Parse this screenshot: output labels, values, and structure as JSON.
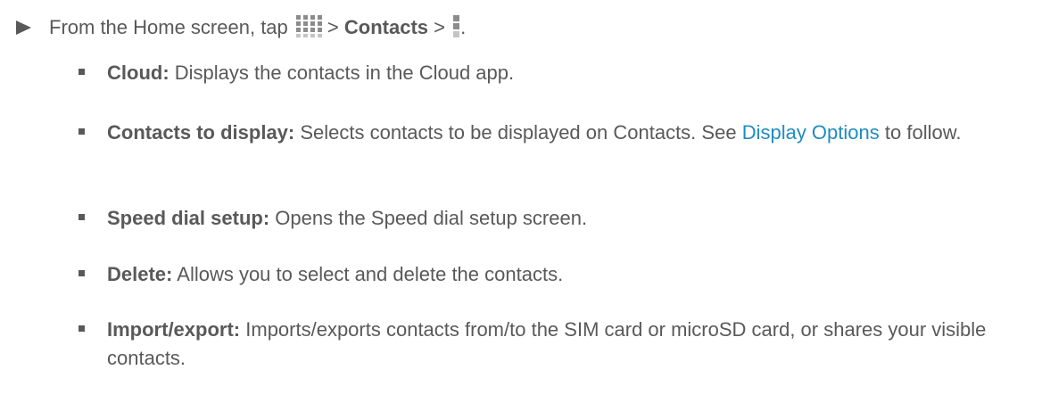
{
  "step": {
    "prefix": "From the Home screen, tap",
    "separator1": ">",
    "contacts_label": "Contacts",
    "separator2": ">",
    "suffix": ".",
    "icons": [
      "apps-grid-icon",
      "menu-icon"
    ]
  },
  "options": [
    {
      "term": "Cloud:",
      "description": "Displays the contacts in the Cloud app."
    },
    {
      "term": "Contacts to display:",
      "description": "Selects contacts to be displayed on Contacts. See",
      "link_text": "Display Options",
      "description_after": "to follow."
    },
    {
      "term": "Speed dial setup:",
      "description": "Opens the Speed dial setup screen."
    },
    {
      "term": "Delete:",
      "description": "Allows you to select and delete the contacts."
    },
    {
      "term": "Import/export:",
      "description": "Imports/exports contacts from/to the SIM card or microSD card, or shares your visible contacts."
    }
  ],
  "colors": {
    "text": "#595959",
    "link": "#1f8cbf"
  }
}
